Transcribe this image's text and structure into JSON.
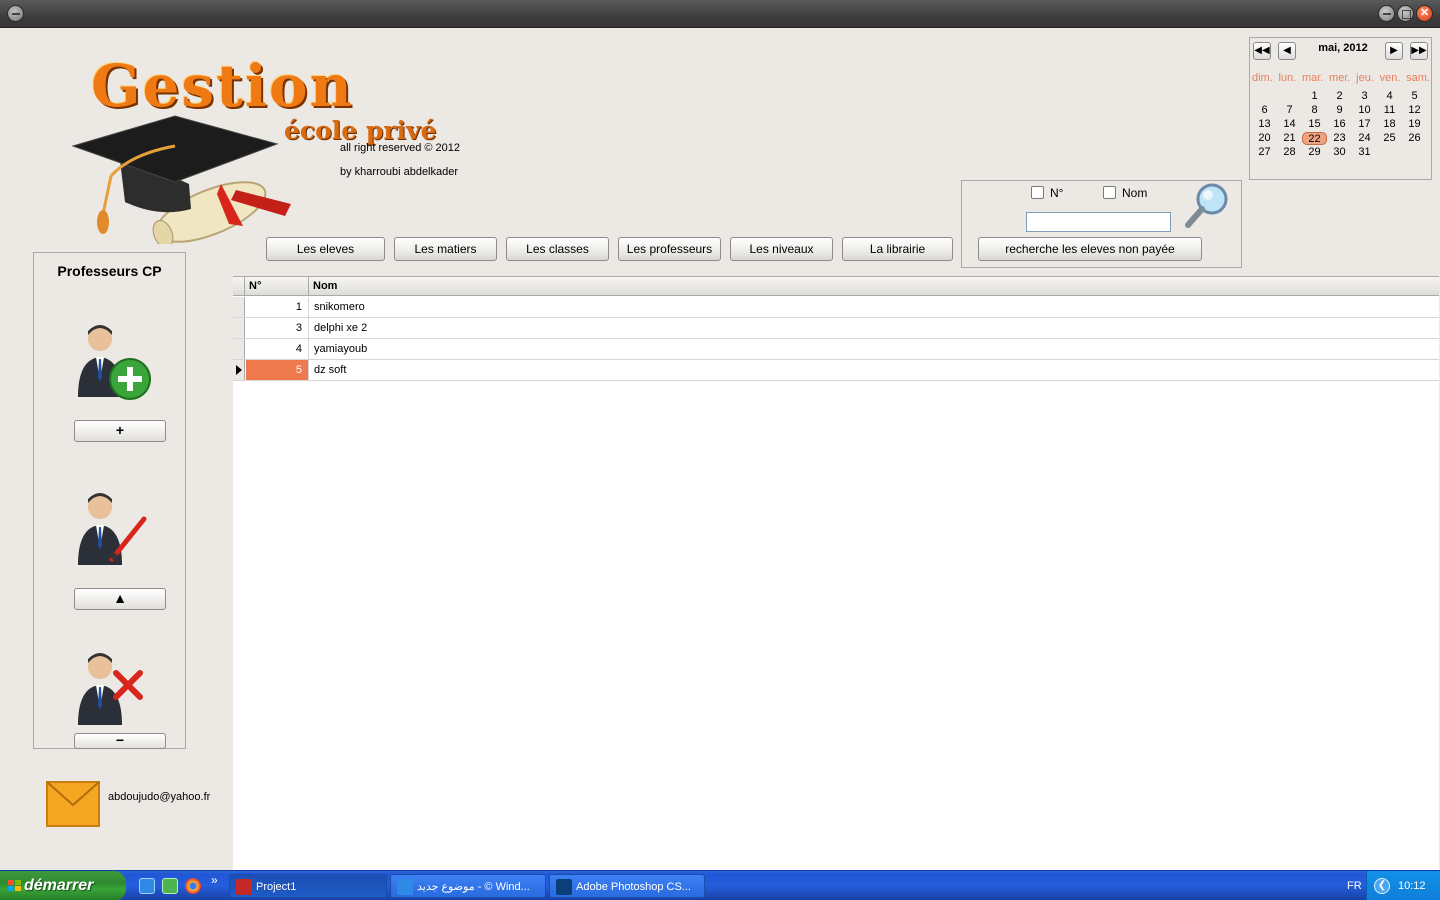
{
  "logo": {
    "title": "Gestion",
    "subtitle": "école privé"
  },
  "credits": {
    "line1": "all right reserved  © 2012",
    "line2": "by kharroubi abdelkader"
  },
  "calendar": {
    "month_label": "mai, 2012",
    "nav": [
      "◀◀",
      "◀",
      "▶",
      "▶▶"
    ],
    "weekdays": [
      "dim.",
      "lun.",
      "mar.",
      "mer.",
      "jeu.",
      "ven.",
      "sam."
    ],
    "days": [
      "",
      "",
      "1",
      "2",
      "3",
      "4",
      "5",
      "6",
      "7",
      "8",
      "9",
      "10",
      "11",
      "12",
      "13",
      "14",
      "15",
      "16",
      "17",
      "18",
      "19",
      "20",
      "21",
      "22",
      "23",
      "24",
      "25",
      "26",
      "27",
      "28",
      "29",
      "30",
      "31",
      "",
      ""
    ],
    "today": "22",
    "accent_color": "#e5805d"
  },
  "search": {
    "checkbox_num": "N°",
    "checkbox_name": "Nom",
    "input_value": "",
    "icon": "magnifier-icon"
  },
  "nav_buttons": {
    "eleves": "Les eleves",
    "matiers": "Les matiers",
    "classes": "Les classes",
    "professeurs": "Les professeurs",
    "niveaux": "Les niveaux",
    "librairie": "La librairie",
    "non_payee": "recherche les eleves non payée"
  },
  "sidebar": {
    "title": "Professeurs CP",
    "add_label": "+",
    "edit_label": "▲",
    "delete_label": "−"
  },
  "contact": {
    "email": "abdoujudo@yahoo.fr"
  },
  "grid": {
    "headers": [
      "N°",
      "Nom"
    ],
    "rows": [
      {
        "num": "1",
        "name": "snikomero"
      },
      {
        "num": "3",
        "name": "delphi xe 2"
      },
      {
        "num": "4",
        "name": "yamiayoub"
      },
      {
        "num": "5",
        "name": "dz soft"
      }
    ],
    "selected_index": 3,
    "selected_color": "#ee7a4d"
  },
  "taskbar": {
    "start_label": "démarrer",
    "tasks": [
      "Project1",
      "موضوع جديد - © Wind...",
      "Adobe Photoshop CS..."
    ],
    "lang": "FR",
    "clock": "10:12",
    "overflow": "»"
  }
}
